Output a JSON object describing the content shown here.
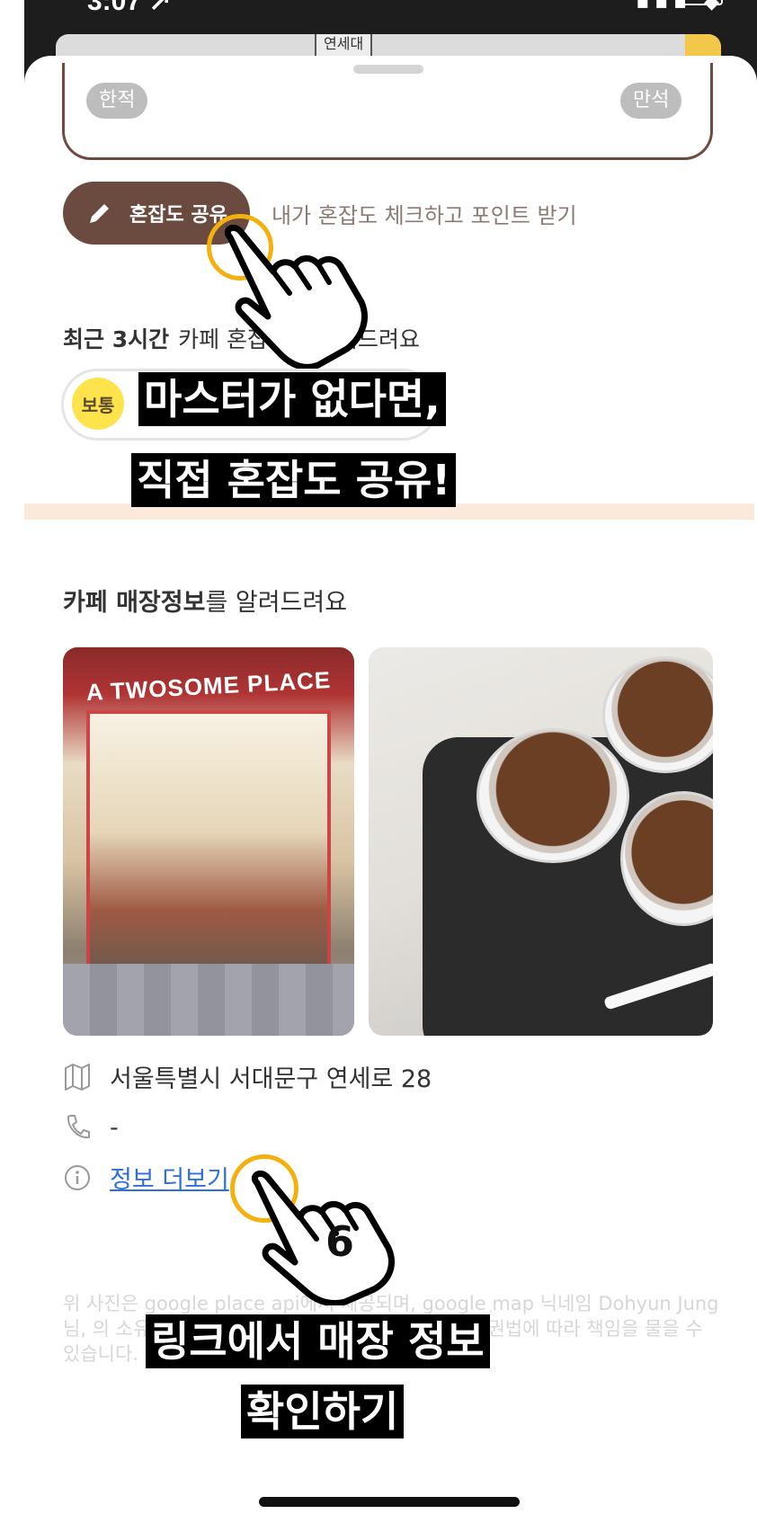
{
  "status_bar": {
    "time": "3:07 ↗",
    "icons": "▪▪▪ ◆"
  },
  "map": {
    "label": "연세대"
  },
  "congestion_gauge": {
    "left_label": "한적",
    "right_label": "만석"
  },
  "share": {
    "button_label": "혼잡도 공유",
    "hint": "내가 혼잡도 체크하고 포인트 받기",
    "icon": "pencil-icon"
  },
  "recent": {
    "title_bold": "최근 3시간",
    "title_rest": "카페 혼잡도를 알려드려요",
    "level_badge": "보통"
  },
  "store_info": {
    "title_bold": "카페 매장정보",
    "title_rest": "를 알려드려요",
    "photo_store_sign": "A TWOSOME PLACE",
    "address": "서울특별시 서대문구 연세로 28",
    "phone": "-",
    "more_link": "정보 더보기",
    "icons": {
      "address": "map-icon",
      "phone": "phone-icon",
      "more": "info-icon"
    }
  },
  "disclaimer": "위 사진은 google place api에서 제공되며, google map 닉네임 Dohyun Jung님, 의 소유입니다. 무단으로 사용 및 배포할 경우 저작권법에 따라 책임을 물을 수 있습니다.",
  "captions": {
    "line1": "마스터가 없다면,",
    "line2": "직접 혼잡도 공유!",
    "line3": "링크에서 매장 정보",
    "line4": "확인하기"
  },
  "step_number": "6",
  "colors": {
    "brown": "#6b4a40",
    "link": "#2f6fd8",
    "badge_yellow": "#ffe34d",
    "tap_ring": "#f2b10e",
    "divider_band": "#fbeadc"
  }
}
